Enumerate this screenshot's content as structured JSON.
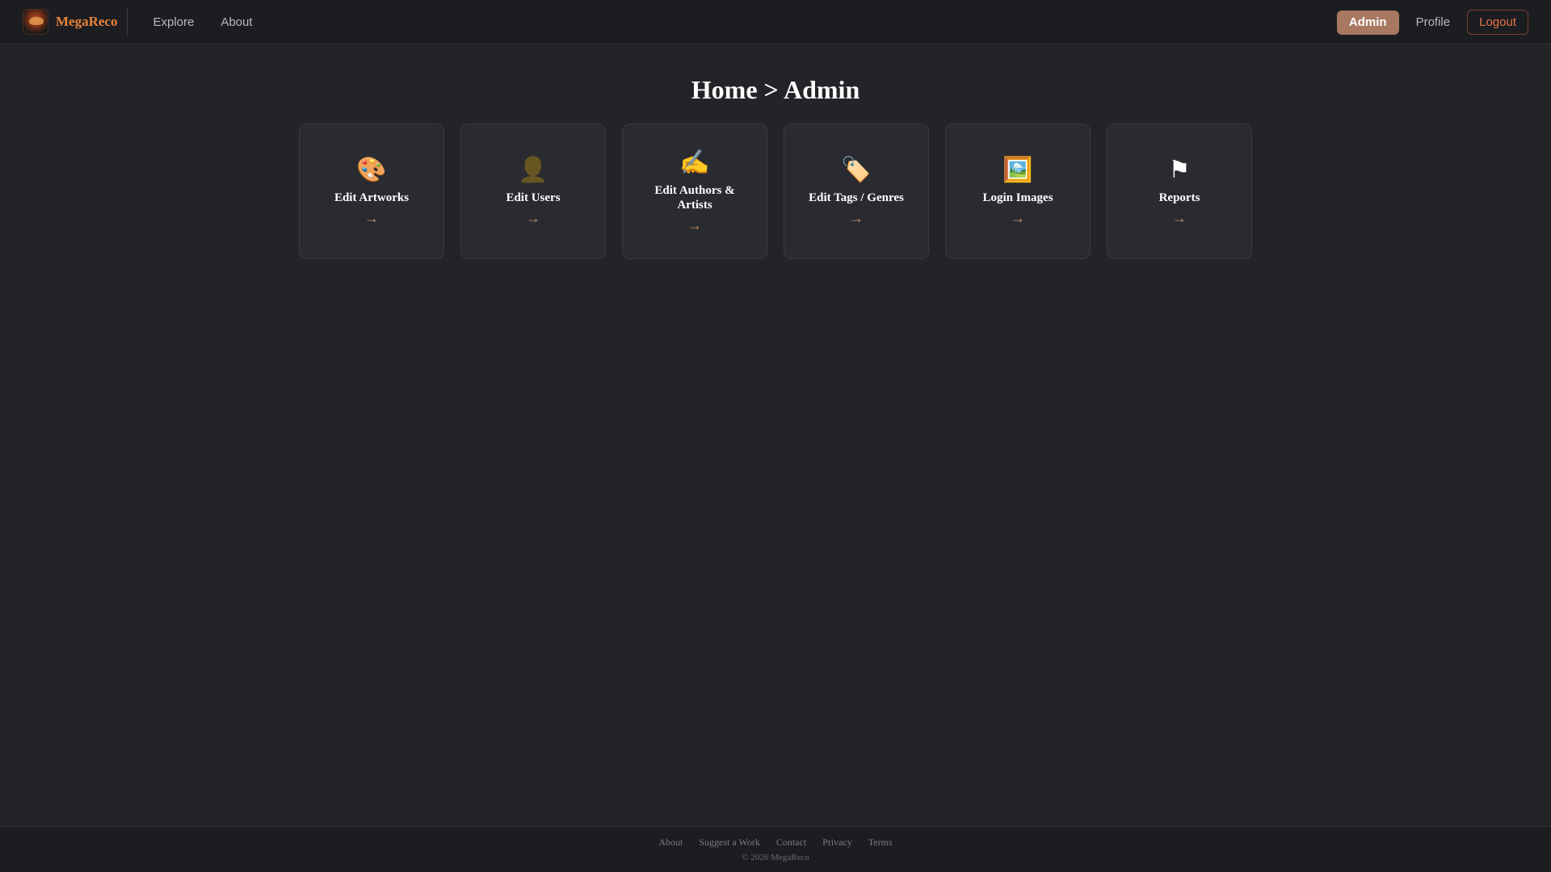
{
  "header": {
    "brand": "MegaReco",
    "nav": [
      "Explore",
      "About"
    ],
    "admin_label": "Admin",
    "profile_label": "Profile",
    "logout_label": "Logout"
  },
  "main": {
    "title": "Home > Admin",
    "cards": [
      {
        "icon": "palette-icon",
        "glyph": "🎨",
        "label": "Edit Artworks",
        "arrow": "→"
      },
      {
        "icon": "user-silhouette-icon",
        "glyph": "👤",
        "label": "Edit Users",
        "arrow": "→"
      },
      {
        "icon": "writing-hand-icon",
        "glyph": "✍️",
        "label": "Edit Authors & Artists",
        "arrow": "→"
      },
      {
        "icon": "tag-icon",
        "glyph": "🏷️",
        "label": "Edit Tags / Genres",
        "arrow": "→"
      },
      {
        "icon": "framed-picture-icon",
        "glyph": "🖼️",
        "label": "Login Images",
        "arrow": "→"
      },
      {
        "icon": "flag-icon",
        "glyph": "⚑",
        "label": "Reports",
        "arrow": "→"
      }
    ]
  },
  "footer": {
    "links": [
      "About",
      "Suggest a Work",
      "Contact",
      "Privacy",
      "Terms"
    ],
    "copyright": "© 2026 MegaReco"
  },
  "colors": {
    "accent": "#e8833a",
    "admin_button": "#a87860",
    "logout": "#e8734a",
    "background": "#232428"
  }
}
